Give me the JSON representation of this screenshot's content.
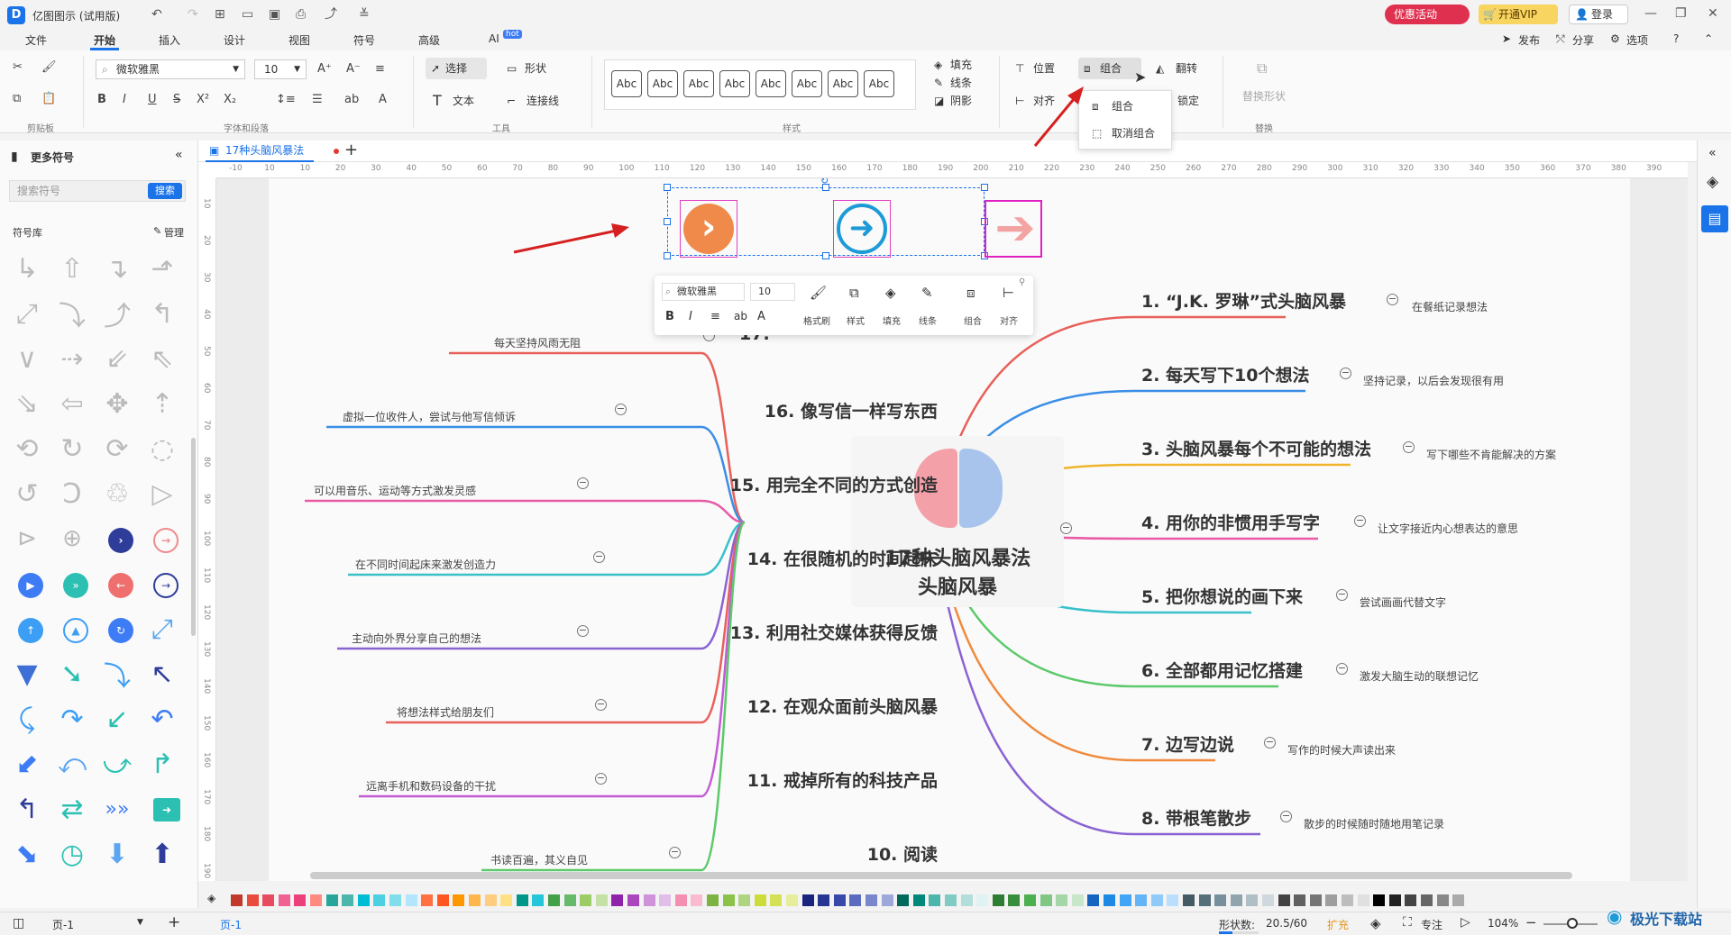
{
  "app": {
    "title": "亿图图示 (试用版)",
    "promo_label": "优惠活动",
    "vip_label": "开通VIP",
    "login_label": "登录"
  },
  "menu": {
    "tabs": [
      "文件",
      "开始",
      "插入",
      "设计",
      "视图",
      "符号",
      "高级",
      "AI"
    ],
    "active": "开始",
    "ai_badge": "hot",
    "right": [
      "发布",
      "分享",
      "选项"
    ]
  },
  "ribbon": {
    "clipboard_label": "剪贴板",
    "font": {
      "name": "微软雅黑",
      "size": "10",
      "group_label": "字体和段落"
    },
    "tools": {
      "select": "选择",
      "shape": "形状",
      "text": "文本",
      "connector": "连接线",
      "group_label": "工具"
    },
    "styles": {
      "items": [
        "Abc",
        "Abc",
        "Abc",
        "Abc",
        "Abc",
        "Abc",
        "Abc",
        "Abc"
      ],
      "group_label": "样式"
    },
    "fill": "填充",
    "line": "线条",
    "shadow": "阴影",
    "position": "位置",
    "align": "对齐",
    "group": "组合",
    "flip": "翻转",
    "lock": "锁定",
    "replace_shape": "替换形状",
    "replace_label": "替换",
    "group_menu": [
      "组合",
      "取消组合"
    ]
  },
  "left_panel": {
    "title": "更多符号",
    "search_placeholder": "搜索符号",
    "search_button": "搜索",
    "library_label": "符号库",
    "manage_label": "管理"
  },
  "doc_tab": {
    "name": "17种头脑风暴法"
  },
  "ruler": {
    "h": [
      "-10",
      "10",
      "10",
      "20",
      "30",
      "40",
      "50",
      "60",
      "70",
      "80",
      "90",
      "100",
      "110",
      "120",
      "130",
      "140",
      "150",
      "160",
      "170",
      "180",
      "190",
      "200",
      "210",
      "220",
      "230",
      "240",
      "250",
      "260",
      "270",
      "280",
      "290",
      "300",
      "310",
      "320",
      "330",
      "340",
      "350",
      "360",
      "370",
      "380",
      "390"
    ],
    "v": [
      "10",
      "20",
      "30",
      "40",
      "50",
      "60",
      "70",
      "80",
      "90",
      "100",
      "110",
      "120",
      "130",
      "140",
      "150",
      "160",
      "170",
      "180",
      "190"
    ]
  },
  "floating_toolbar": {
    "font": "微软雅黑",
    "size": "10",
    "items": [
      "格式刷",
      "样式",
      "填充",
      "线条",
      "组合",
      "对齐"
    ]
  },
  "mindmap": {
    "center": [
      "17种头脑风暴法",
      "头脑风暴"
    ],
    "right": [
      {
        "title": "1.  “J.K. 罗琳”式头脑风暴",
        "note": "在餐纸记录想法",
        "color": "#e8605a"
      },
      {
        "title": "2. 每天写下10个想法",
        "note": "坚持记录，以后会发现很有用",
        "color": "#3a8ee6"
      },
      {
        "title": "3. 头脑风暴每个不可能的想法",
        "note": "写下哪些不肯能解决的方案",
        "color": "#f0b429"
      },
      {
        "title": "4. 用你的非惯用手写字",
        "note": "让文字接近内心想表达的意思",
        "color": "#e95aa6"
      },
      {
        "title": "5. 把你想说的画下来",
        "note": "尝试画画代替文字",
        "color": "#38c1c9"
      },
      {
        "title": "6. 全部都用记忆搭建",
        "note": "激发大脑生动的联想记忆",
        "color": "#5cc96a"
      },
      {
        "title": "7. 边写边说",
        "note": "写作的时候大声读出来",
        "color": "#f08a3c"
      },
      {
        "title": "8. 带根笔散步",
        "note": "散步的时候随时随地用笔记录",
        "color": "#8a63d2"
      }
    ],
    "left": [
      {
        "title": "17.",
        "note": "每天坚持风雨无阻",
        "color": "#e8605a"
      },
      {
        "title": "16. 像写信一样写东西",
        "note": "虚拟一位收件人，尝试与他写信倾诉",
        "color": "#3a8ee6"
      },
      {
        "title": "15. 用完全不同的方式创造",
        "note": "可以用音乐、运动等方式激发灵感",
        "color": "#e95aa6"
      },
      {
        "title": "14. 在很随机的时间起床",
        "note": "在不同时间起床来激发创造力",
        "color": "#38c1c9"
      },
      {
        "title": "13. 利用社交媒体获得反馈",
        "note": "主动向外界分享自己的想法",
        "color": "#8a63d2"
      },
      {
        "title": "12. 在观众面前头脑风暴",
        "note": "将想法样式给朋友们",
        "color": "#e8605a"
      },
      {
        "title": "11. 戒掉所有的科技产品",
        "note": "远离手机和数码设备的干扰",
        "color": "#c25ad6"
      },
      {
        "title": "10. 阅读",
        "note": "书读百遍，其义自见",
        "color": "#5cc96a"
      }
    ]
  },
  "status": {
    "page_name": "页-1",
    "page_tab": "页-1",
    "shape_count_label": "形状数:",
    "shape_count": "20.5/60",
    "expand": "扩充",
    "focus": "专注",
    "zoom": "104%"
  },
  "watermark": "极光下载站",
  "colors": {
    "accent": "#1a73e8",
    "red_arrow": "#d62020",
    "orange": "#f08a4a",
    "blue": "#1e9bd7",
    "pink": "#f4a3a3"
  },
  "palette": [
    "#c0392b",
    "#e74c3c",
    "#e84a5f",
    "#f06292",
    "#ec407a",
    "#ff8a80",
    "#26a69a",
    "#4db6ac",
    "#00bcd4",
    "#4dd0e1",
    "#80deea",
    "#b3e5fc",
    "#ff7043",
    "#ff5722",
    "#ff9800",
    "#ffb74d",
    "#ffcc80",
    "#ffe082",
    "#009688",
    "#26c6da",
    "#43a047",
    "#66bb6a",
    "#9ccc65",
    "#c5e1a5",
    "#8e24aa",
    "#ab47bc",
    "#ce93d8",
    "#e1bee7",
    "#f48fb1",
    "#f8bbd0",
    "#7cb342",
    "#8bc34a",
    "#aed581",
    "#cddc39",
    "#d4e157",
    "#e6ee9c",
    "#1a237e",
    "#283593",
    "#3949ab",
    "#5c6bc0",
    "#7986cb",
    "#9fa8da",
    "#00695c",
    "#00897b",
    "#4db6ac",
    "#80cbc4",
    "#b2dfdb",
    "#e0f2f1",
    "#2e7d32",
    "#388e3c",
    "#4caf50",
    "#81c784",
    "#a5d6a7",
    "#c8e6c9",
    "#1565c0",
    "#1e88e5",
    "#42a5f5",
    "#64b5f6",
    "#90caf9",
    "#bbdefb",
    "#455a64",
    "#546e7a",
    "#78909c",
    "#90a4ae",
    "#b0bec5",
    "#cfd8dc",
    "#424242",
    "#616161",
    "#757575",
    "#9e9e9e",
    "#bdbdbd",
    "#e0e0e0",
    "#000000",
    "#222222",
    "#444444",
    "#666666",
    "#888888",
    "#aaaaaa"
  ]
}
